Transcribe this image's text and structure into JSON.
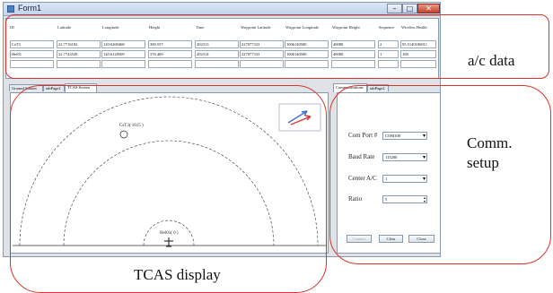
{
  "window": {
    "title": "Form1",
    "min": "–",
    "max": "□",
    "close": "✕"
  },
  "grid": {
    "headers": [
      "ID",
      "Latitude",
      "Longitude",
      "Height",
      "Time",
      "Waypoint Latitude",
      "Waypoint Longitude",
      "Waypoint Height",
      "Sequence",
      "Wireless Health"
    ],
    "rows": [
      [
        "CsT3",
        "22.7716182",
        "120.6269468",
        "390.557",
        "202313",
        "227077333",
        "1006140500",
        "40080",
        "2",
        "95.5140106911"
      ],
      [
        "Hel01",
        "22.7743549",
        "120.6128509",
        "376.469",
        "202314",
        "227077333",
        "1006140500",
        "40080",
        "1",
        "108"
      ],
      [
        "",
        "",
        "",
        "",
        "",
        "",
        "",
        "",
        "",
        ""
      ]
    ]
  },
  "tabs_left": [
    "Ground Station",
    "tabPage2",
    "TCAS Screen"
  ],
  "tabs_right": [
    "Communications",
    "tabPage2"
  ],
  "tcas": {
    "target_label": "CsT3( 1615 )",
    "own_label": "Hel01( 0 )"
  },
  "comm": {
    "com_port_label": "Com Port #",
    "com_port_value": "COM100",
    "baud_label": "Baud Rate",
    "baud_value": "115200",
    "center_label": "Center A/C",
    "center_value": "1",
    "ratio_label": "Ratio",
    "ratio_value": "5",
    "connect": "Connect",
    "clear": "Clear",
    "close": "Close"
  },
  "annotations": {
    "ac_data": "a/c data",
    "comm_setup_1": "Comm.",
    "comm_setup_2": "setup",
    "tcas_display": "TCAS display"
  },
  "colors": {
    "annotation": "#d9342b",
    "arrow_blue": "#3a6fd8",
    "arrow_red": "#d83a3a"
  }
}
